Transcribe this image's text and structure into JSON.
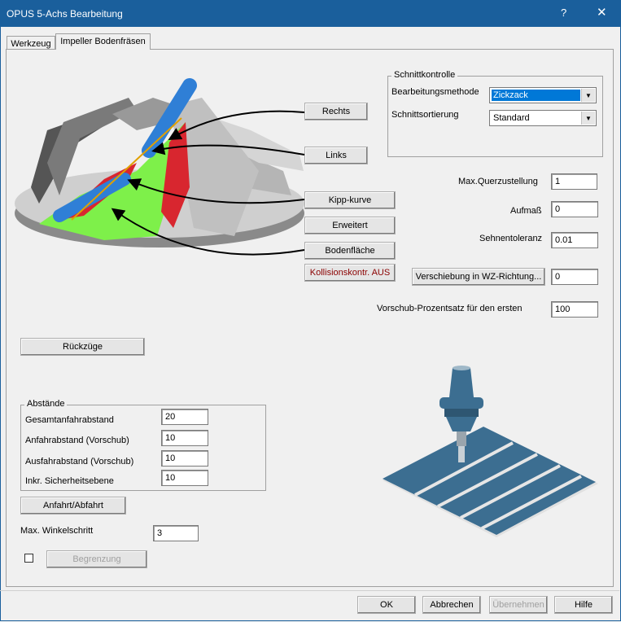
{
  "window": {
    "title": "OPUS 5-Achs Bearbeitung",
    "help_glyph": "?",
    "close_glyph": "✕"
  },
  "tabs": [
    {
      "label": "Werkzeug",
      "active": false
    },
    {
      "label": "Impeller Bodenfräsen",
      "active": true
    }
  ],
  "illustration_buttons": {
    "rechts": "Rechts",
    "links": "Links",
    "kipp": "Kipp-kurve",
    "erweitert": "Erweitert",
    "boden": "Bodenfläche",
    "kollision": "Kollisionskontr. AUS"
  },
  "schnittkontrolle": {
    "legend": "Schnittkontrolle",
    "methode_label": "Bearbeitungsmethode",
    "methode_value": "Zickzack",
    "ortierung_label": "Schnittsortierung",
    "ortierung_value": "Standard"
  },
  "params": {
    "querzustellung_label": "Max.Querzustellung",
    "querzustellung_value": "1",
    "aufmass_label": "Aufmaß",
    "aufmass_value": "0",
    "sehnentoleranz_label": "Sehnentoleranz",
    "sehnentoleranz_value": "0.01",
    "verschiebung_button": "Verschiebung in WZ-Richtung...",
    "verschiebung_value": "0",
    "vorschub_label": "Vorschub-Prozentsatz für den ersten",
    "vorschub_value": "100"
  },
  "rueckzuege_button": "Rückzüge",
  "abstaende": {
    "legend": "Abstände",
    "gesamt_label": "Gesamtanfahrabstand",
    "gesamt_value": "20",
    "anfahr_label": "Anfahrabstand (Vorschub)",
    "anfahr_value": "10",
    "ausfahr_label": "Ausfahrabstand (Vorschub)",
    "ausfahr_value": "10",
    "inkr_label": "Inkr. Sicherheitsebene",
    "inkr_value": "10"
  },
  "anfahrt_button": "Anfahrt/Abfahrt",
  "winkel_label": "Max. Winkelschritt",
  "winkel_value": "3",
  "begrenzung_button": "Begrenzung",
  "footer": {
    "ok": "OK",
    "cancel": "Abbrechen",
    "apply": "Übernehmen",
    "help": "Hilfe"
  },
  "colors": {
    "titlebar": "#1a5f9c",
    "selection": "#0078d7",
    "kollision_text": "#8b0000",
    "floor_green": "#7ef04a",
    "wall_red": "#d8262f",
    "tool_blue": "#2f7fd6"
  }
}
